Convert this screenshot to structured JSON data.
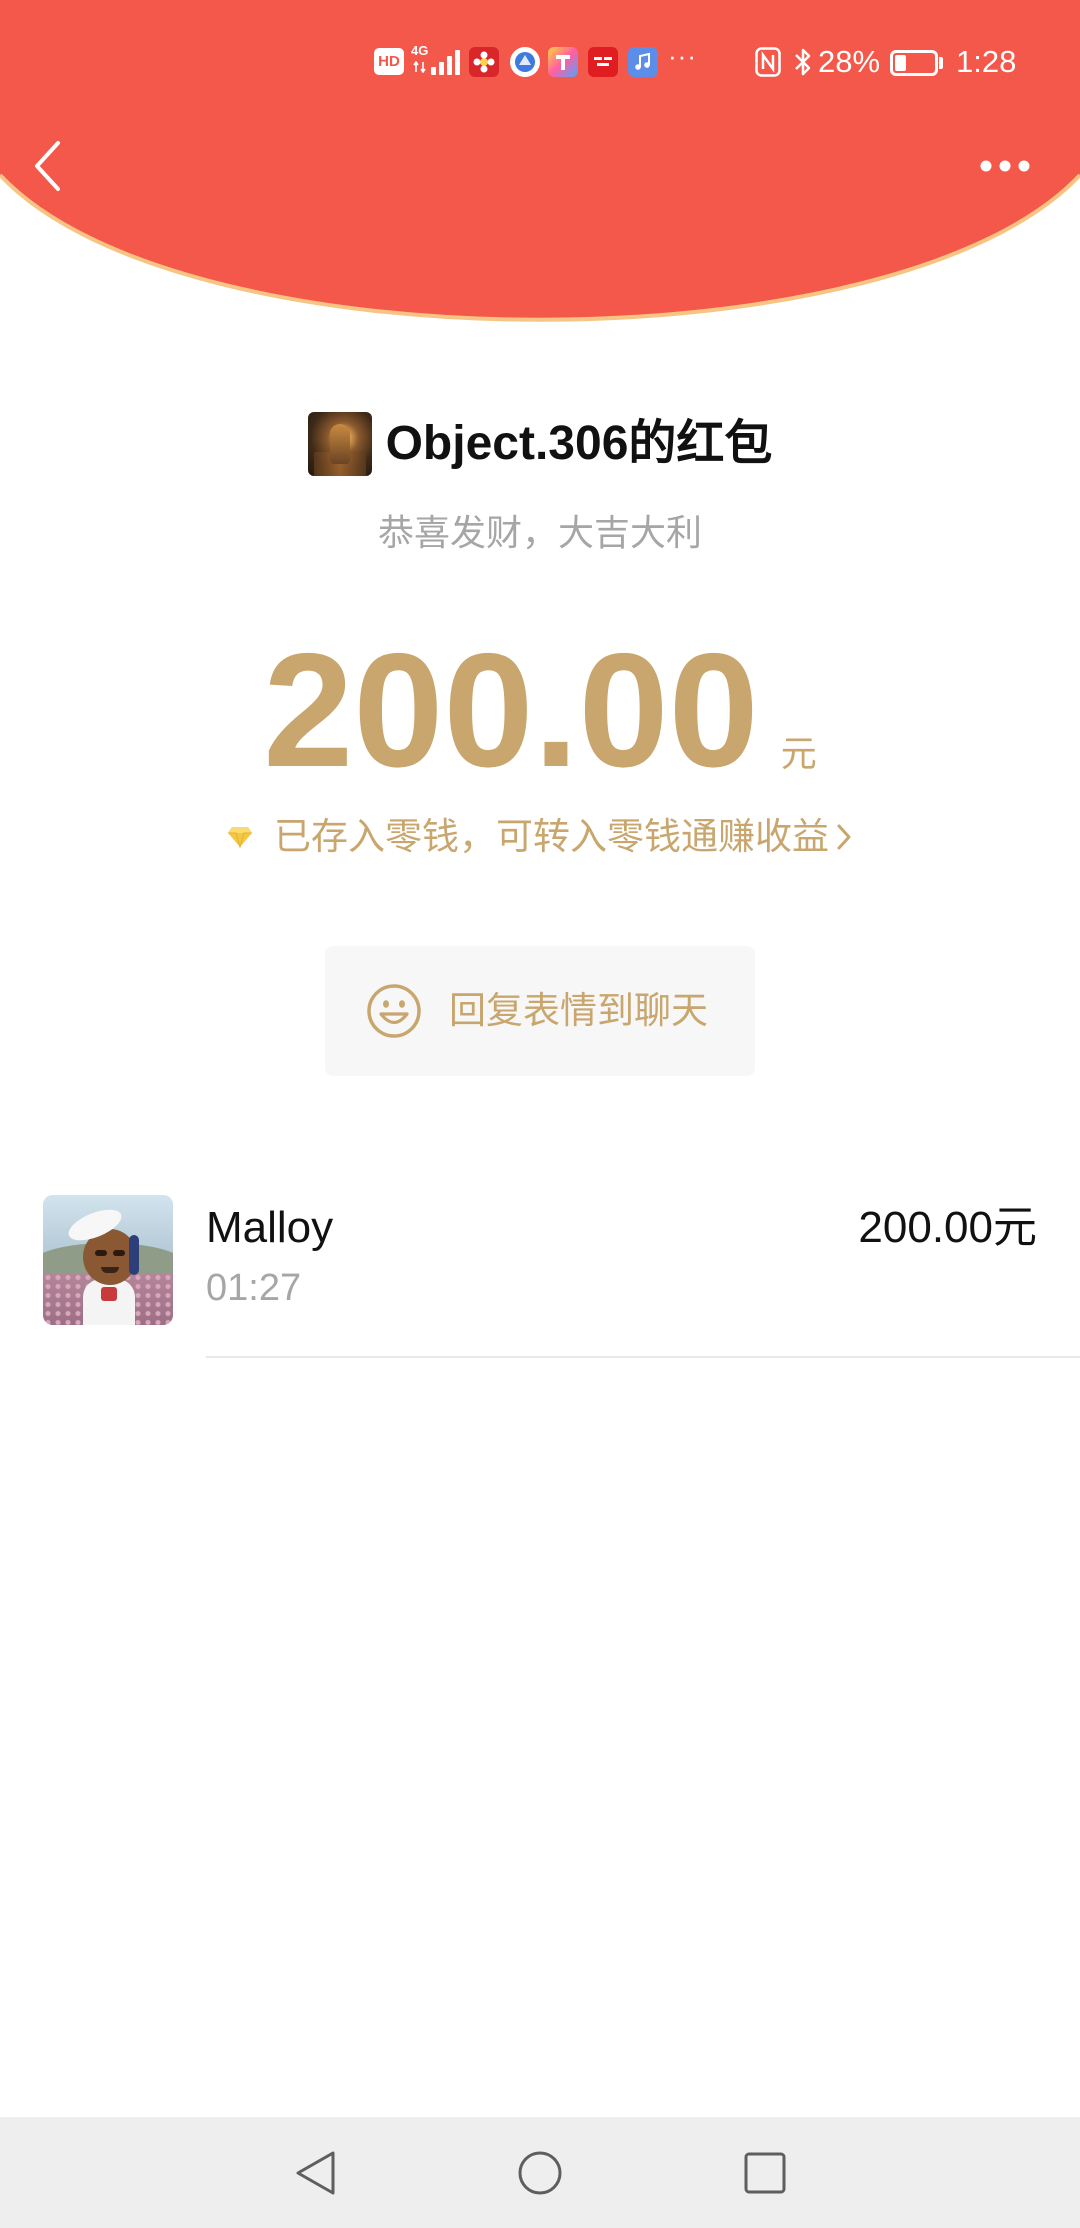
{
  "theme": {
    "header_red": "#F3584A",
    "header_border": "#F7C583",
    "gold": "#C8A66D",
    "text_secondary": "#A6A6A6",
    "nav_bar_bg": "#EEEEEE"
  },
  "status_bar": {
    "hd_label": "HD",
    "network_label": "4G",
    "signal_icon": "cellular-signal-icon",
    "notification_icons": [
      "flower-app-icon",
      "browser-app-icon",
      "colorful-app-icon",
      "red-app-icon",
      "music-app-icon"
    ],
    "overflow_label": "···",
    "nfc_icon": "nfc-icon",
    "bluetooth_icon": "bluetooth-icon",
    "battery_percent_label": "28%",
    "battery_level": 0.28,
    "time": "1:28"
  },
  "header": {
    "back_icon": "chevron-left-icon",
    "more_icon": "more-dots-icon"
  },
  "envelope": {
    "title": "Object.306的红包",
    "greeting": "恭喜发财，大吉大利",
    "amount": "200.00",
    "currency": "元",
    "notice_icon": "diamond-icon",
    "notice": "已存入零钱，可转入零钱通赚收益",
    "notice_chevron": "chevron-right-icon"
  },
  "reply_button": {
    "icon": "smiley-icon",
    "label": "回复表情到聊天"
  },
  "receivers": [
    {
      "name": "Malloy",
      "time": "01:27",
      "amount": "200.00元"
    }
  ],
  "nav_bar": {
    "back_icon": "triangle-back-icon",
    "home_icon": "circle-home-icon",
    "recents_icon": "square-recents-icon"
  }
}
